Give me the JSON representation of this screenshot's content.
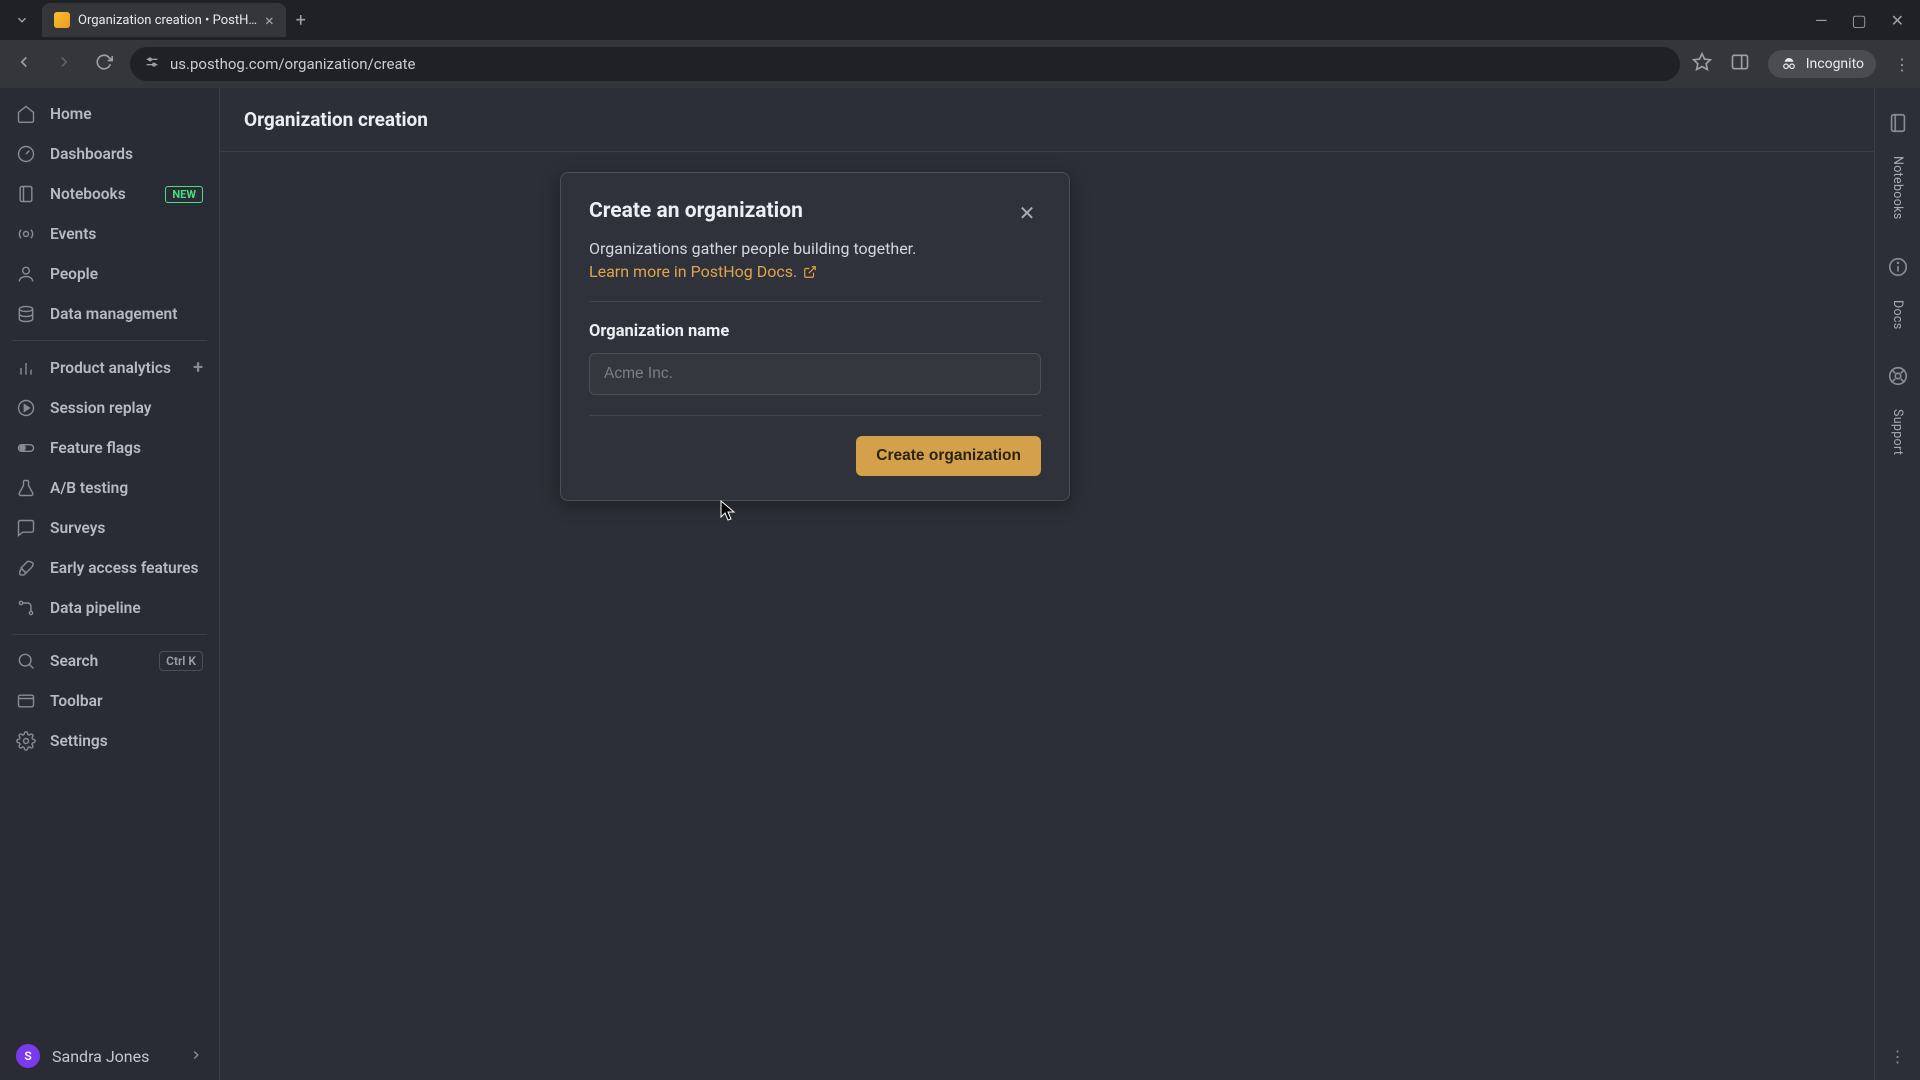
{
  "browser": {
    "tab_title": "Organization creation • PostH…",
    "url": "us.posthog.com/organization/create",
    "incognito_label": "Incognito"
  },
  "sidebar": {
    "items": [
      {
        "label": "Home"
      },
      {
        "label": "Dashboards"
      },
      {
        "label": "Notebooks",
        "badge": "NEW"
      },
      {
        "label": "Events"
      },
      {
        "label": "People"
      },
      {
        "label": "Data management"
      }
    ],
    "items2": [
      {
        "label": "Product analytics",
        "plus": true
      },
      {
        "label": "Session replay"
      },
      {
        "label": "Feature flags"
      },
      {
        "label": "A/B testing"
      },
      {
        "label": "Surveys"
      },
      {
        "label": "Early access features"
      },
      {
        "label": "Data pipeline"
      }
    ],
    "items3": [
      {
        "label": "Search",
        "shortcut": "Ctrl K"
      },
      {
        "label": "Toolbar"
      },
      {
        "label": "Settings"
      }
    ],
    "user": {
      "initial": "S",
      "name": "Sandra Jones"
    }
  },
  "page": {
    "title": "Organization creation"
  },
  "modal": {
    "title": "Create an organization",
    "description": "Organizations gather people building together.",
    "docs_link": "Learn more in PostHog Docs.",
    "field_label": "Organization name",
    "placeholder": "Acme Inc.",
    "submit_label": "Create organization"
  },
  "rail": {
    "notebooks": "Notebooks",
    "docs": "Docs",
    "support": "Support"
  }
}
